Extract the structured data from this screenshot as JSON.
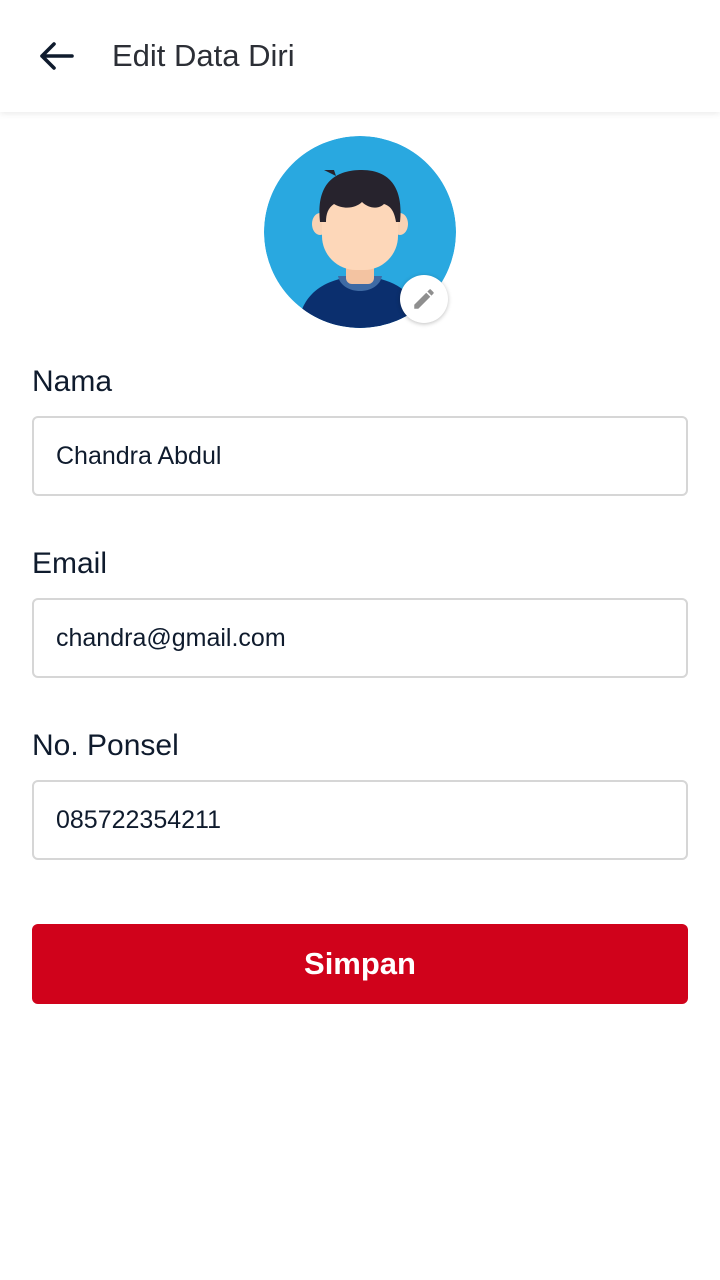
{
  "header": {
    "title": "Edit Data Diri",
    "back_icon": "arrow-left-icon"
  },
  "profile": {
    "avatar_icon": "user-avatar",
    "edit_icon": "pencil-icon",
    "avatar_bg": "#29a8e0"
  },
  "form": {
    "name_label": "Nama",
    "name_value": "Chandra Abdul",
    "email_label": "Email",
    "email_value": "chandra@gmail.com",
    "phone_label": "No. Ponsel",
    "phone_value": "085722354211"
  },
  "actions": {
    "save_label": "Simpan",
    "save_color": "#d0021b"
  }
}
